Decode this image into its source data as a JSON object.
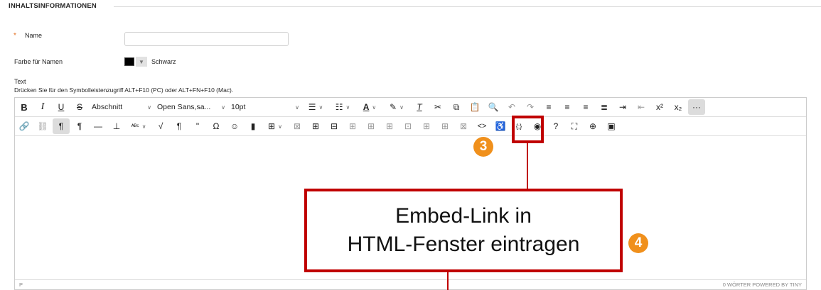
{
  "section": {
    "title": "INHALTSINFORMATIONEN"
  },
  "name_field": {
    "required_marker": "*",
    "label": "Name",
    "value": ""
  },
  "color_field": {
    "label": "Farbe für Namen",
    "value": "Schwarz",
    "swatch_color": "#000000"
  },
  "text_field": {
    "label": "Text",
    "hint": "Drücken Sie für den Symbolleistenzugriff ALT+F10 (PC) oder ALT+FN+F10 (Mac)."
  },
  "toolbar1": {
    "bold": "B",
    "italic": "I",
    "underline": "U",
    "strikethrough": "S",
    "block_format": "Abschnitt",
    "font_family": "Open Sans,sa...",
    "font_size": "10pt",
    "more": "···"
  },
  "toolbar2": {
    "ltr": "¶",
    "rtl": "¶",
    "pilcrow": "¶",
    "blockquote": "\"",
    "omega": "Ω",
    "code_sample": "{;}",
    "source_code": "<>"
  },
  "statusbar": {
    "path": "P",
    "right": "0 WÖRTER  POWERED BY TINY"
  },
  "callout": {
    "line1": "Embed-Link in",
    "line2": "HTML-Fenster eintragen"
  },
  "badges": {
    "step3": "3",
    "step4": "4"
  },
  "colors": {
    "accent_red": "#c00000",
    "badge_orange": "#f0901c",
    "required_orange": "#e36d1e"
  }
}
